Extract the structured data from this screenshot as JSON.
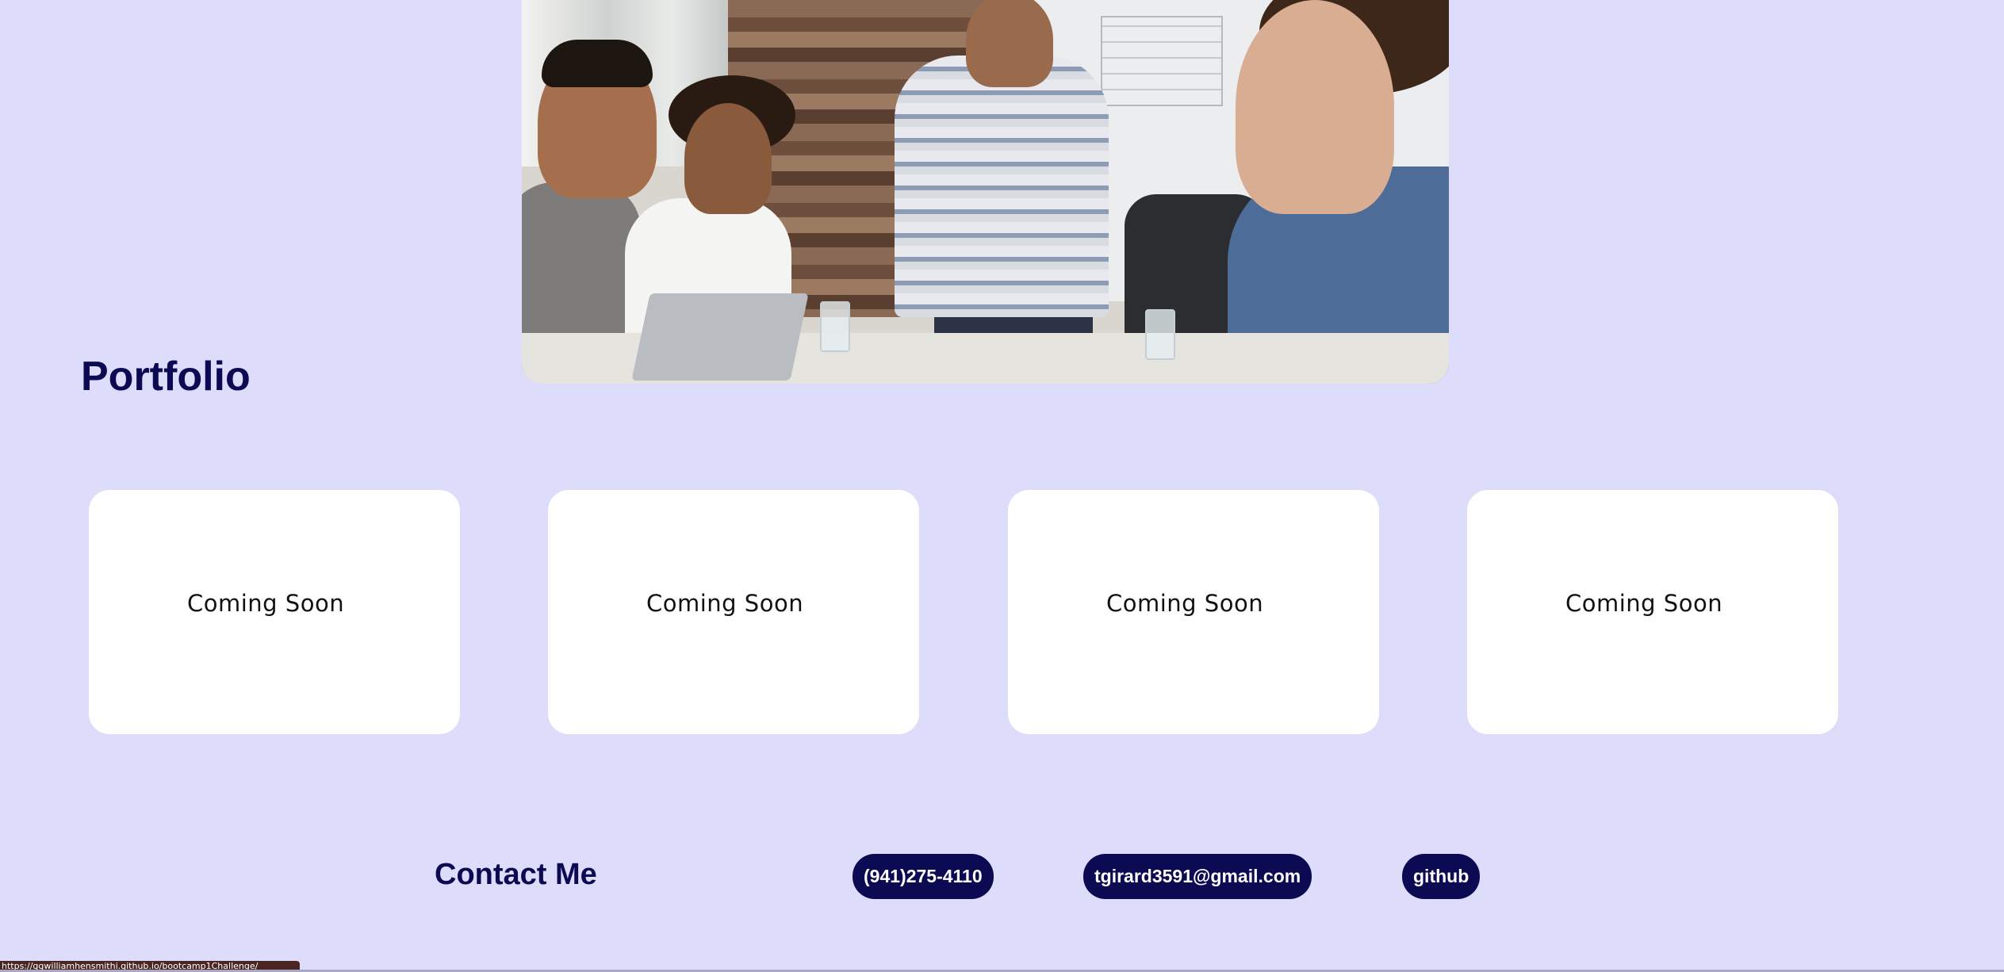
{
  "hero": {
    "image_alt": "team-meeting-photo"
  },
  "portfolio": {
    "title": "Portfolio",
    "cards": [
      {
        "label": "Coming Soon"
      },
      {
        "label": "Coming Soon"
      },
      {
        "label": "Coming Soon"
      },
      {
        "label": "Coming Soon"
      }
    ]
  },
  "contact": {
    "title": "Contact Me",
    "phone": "(941)275-4110",
    "email": "tgirard3591@gmail.com",
    "github": "github"
  },
  "status_bar": {
    "url": "https://ggwilliamhensmithi.github.io/bootcamp1Challenge/"
  },
  "colors": {
    "background": "#dddcfb",
    "accent": "#0b0a53",
    "card": "#ffffff"
  }
}
